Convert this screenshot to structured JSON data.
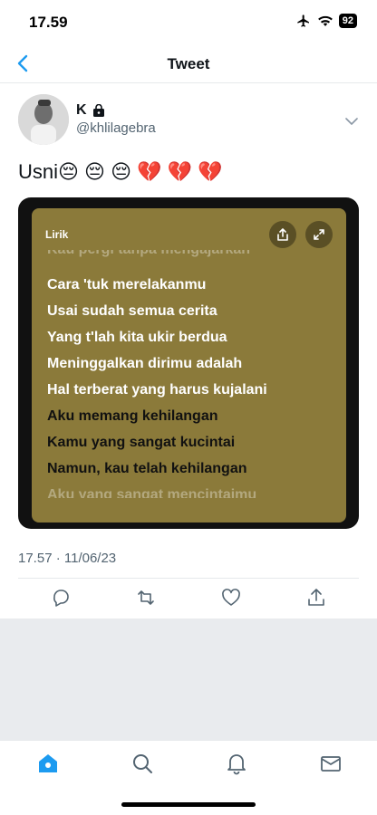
{
  "status_bar": {
    "time": "17.59",
    "battery": "92"
  },
  "header": {
    "title": "Tweet"
  },
  "tweet": {
    "display_name": "K",
    "handle": "@khlilagebra",
    "text": "Usni😔 😔 😔 💔 💔 💔",
    "timestamp": "17.57 · 11/06/23"
  },
  "lyrics_card": {
    "label": "Lirik",
    "background_color": "#8b7a3a",
    "lines": [
      "Kau pergi tanpa mengajarkan",
      "Cara 'tuk merelakanmu",
      "Usai sudah semua cerita",
      "Yang t'lah kita ukir berdua",
      "Meninggalkan dirimu adalah",
      "Hal terberat yang harus kujalani",
      "Aku memang kehilangan",
      "Kamu yang sangat kucintai",
      "Namun, kau telah kehilangan",
      "Aku yang sangat mencintaimu"
    ]
  },
  "colors": {
    "accent": "#1d9bf0",
    "secondary_text": "#536471"
  },
  "icons": {
    "back": "chevron-left-icon",
    "more": "chevron-down-icon",
    "reply": "reply-icon",
    "retweet": "retweet-icon",
    "like": "heart-icon",
    "share": "share-icon",
    "home": "home-icon",
    "search": "search-icon",
    "notifications": "bell-icon",
    "messages": "mail-icon"
  }
}
